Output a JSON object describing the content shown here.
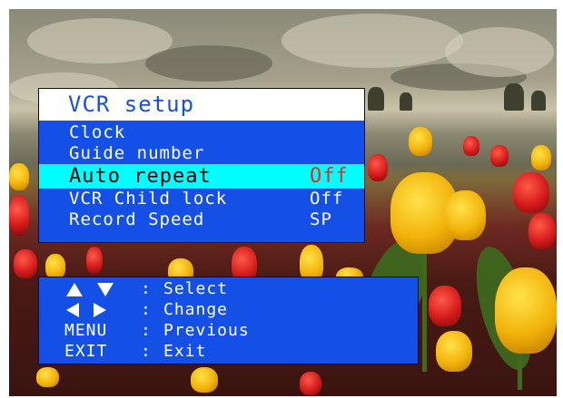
{
  "menu": {
    "title": "VCR setup",
    "items": [
      {
        "label": "Clock",
        "value": ""
      },
      {
        "label": "Guide number",
        "value": ""
      },
      {
        "label": "Auto repeat",
        "value": "Off",
        "selected": true
      },
      {
        "label": "VCR Child lock",
        "value": "Off"
      },
      {
        "label": "Record Speed",
        "value": "SP"
      }
    ]
  },
  "help": {
    "rows": [
      {
        "key_icons": [
          "triangle-up-icon",
          "triangle-down-icon"
        ],
        "separator": ":",
        "desc": "Select"
      },
      {
        "key_icons": [
          "triangle-left-icon",
          "triangle-right-icon"
        ],
        "separator": ":",
        "desc": "Change"
      },
      {
        "key": "MENU",
        "separator": ":",
        "desc": "Previous"
      },
      {
        "key": "EXIT",
        "separator": ":",
        "desc": "Exit"
      }
    ]
  },
  "colors": {
    "menu_background": "#1450e6",
    "title_background": "#ffffff",
    "title_text": "#1450e6",
    "highlight_background": "#00ffff",
    "highlight_value": "#ff2020",
    "text": "#ffffff"
  }
}
